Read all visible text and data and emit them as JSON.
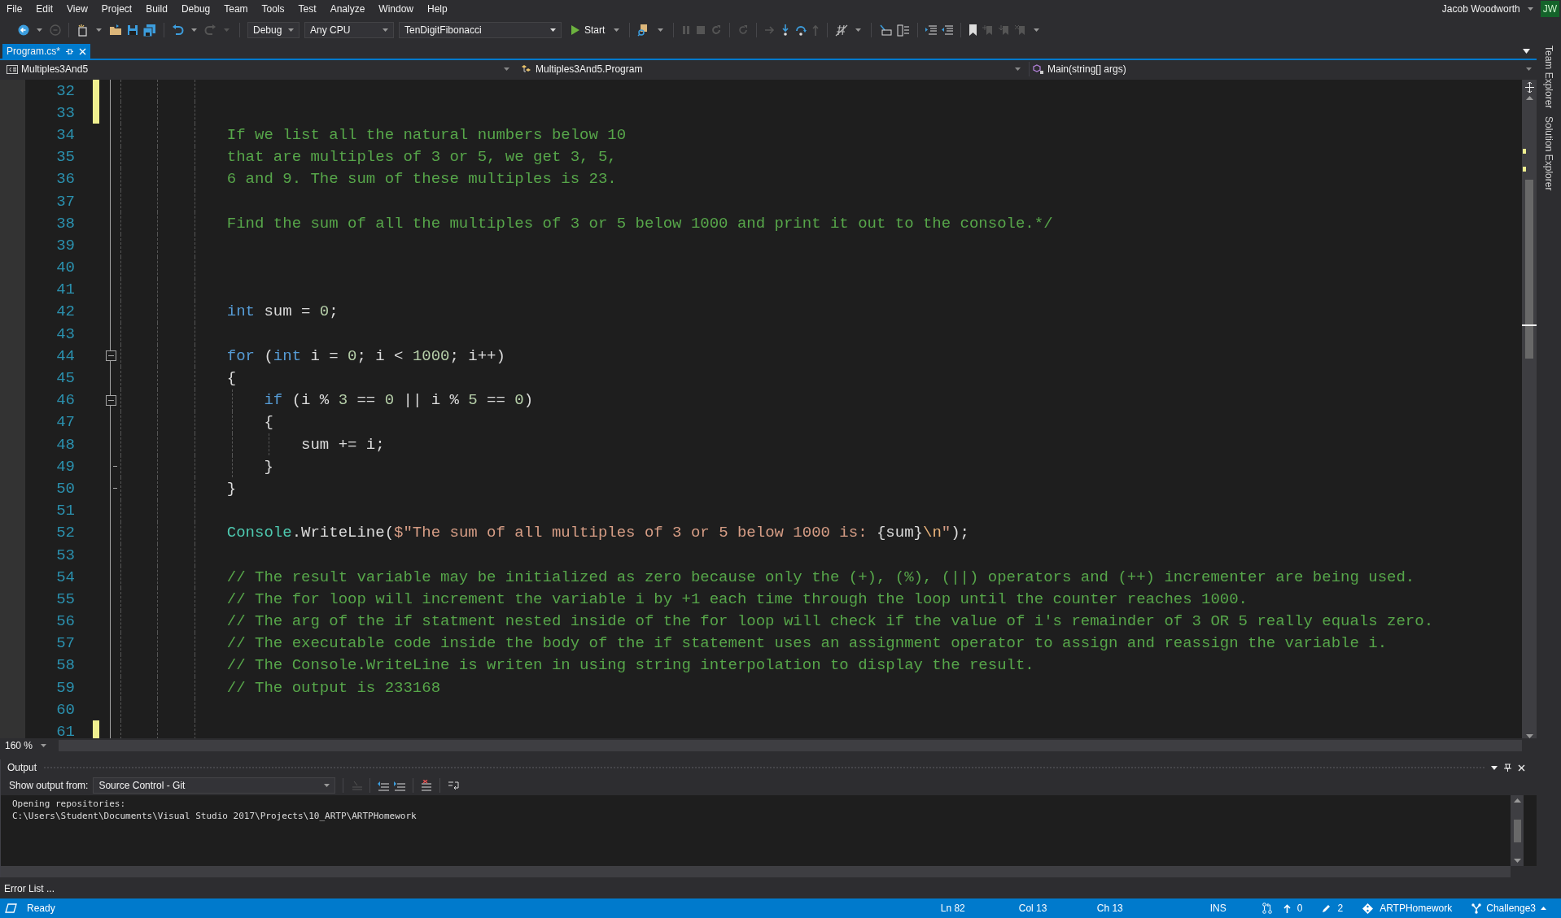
{
  "menu": [
    "File",
    "Edit",
    "View",
    "Project",
    "Build",
    "Debug",
    "Team",
    "Tools",
    "Test",
    "Analyze",
    "Window",
    "Help"
  ],
  "user": {
    "name": "Jacob Woodworth",
    "initials": "JW"
  },
  "toolbar": {
    "configuration": "Debug",
    "platform": "Any CPU",
    "startup_project": "TenDigitFibonacci",
    "start_label": "Start"
  },
  "tabs": [
    {
      "label": "Program.cs*",
      "selected": true
    }
  ],
  "navigation": {
    "project": "Multiples3And5",
    "type": "Multiples3And5.Program",
    "member": "Main(string[] args)"
  },
  "editor": {
    "zoom": "160 %",
    "lines": [
      {
        "n": "32",
        "changed": true
      },
      {
        "n": "33",
        "changed": true
      },
      {
        "n": "34",
        "changed": false,
        "tokens": [
          {
            "kind": "comment",
            "text": "If we list all the natural numbers below 10"
          }
        ]
      },
      {
        "n": "35",
        "changed": false,
        "tokens": [
          {
            "kind": "comment",
            "text": "that are multiples of 3 or 5, we get 3, 5,"
          }
        ]
      },
      {
        "n": "36",
        "changed": false,
        "tokens": [
          {
            "kind": "comment",
            "text": "6 and 9. The sum of these multiples is 23."
          }
        ]
      },
      {
        "n": "37",
        "changed": false
      },
      {
        "n": "38",
        "changed": false,
        "tokens": [
          {
            "kind": "comment",
            "text": "Find the sum of all the multiples of 3 or 5 below 1000 and print it out to the console.*/"
          }
        ]
      },
      {
        "n": "39",
        "changed": false
      },
      {
        "n": "40",
        "changed": false
      },
      {
        "n": "41",
        "changed": false
      },
      {
        "n": "42",
        "changed": false,
        "tokens": [
          {
            "kind": "keyword",
            "text": "int"
          },
          {
            "kind": "plain",
            "text": " sum = "
          },
          {
            "kind": "number",
            "text": "0"
          },
          {
            "kind": "plain",
            "text": ";"
          }
        ]
      },
      {
        "n": "43",
        "changed": false
      },
      {
        "n": "44",
        "changed": false,
        "expanded": true,
        "tokens": [
          {
            "kind": "keyword",
            "text": "for"
          },
          {
            "kind": "plain",
            "text": " ("
          },
          {
            "kind": "keyword",
            "text": "int"
          },
          {
            "kind": "plain",
            "text": " i = "
          },
          {
            "kind": "number",
            "text": "0"
          },
          {
            "kind": "plain",
            "text": "; i < "
          },
          {
            "kind": "number",
            "text": "1000"
          },
          {
            "kind": "plain",
            "text": "; i++)"
          }
        ]
      },
      {
        "n": "45",
        "changed": false,
        "tokens": [
          {
            "kind": "plain",
            "text": "{"
          }
        ]
      },
      {
        "n": "46",
        "changed": false,
        "expanded": true,
        "tokens": [
          {
            "kind": "keyword",
            "text": "    if"
          },
          {
            "kind": "plain",
            "text": " (i % "
          },
          {
            "kind": "number",
            "text": "3"
          },
          {
            "kind": "plain",
            "text": " == "
          },
          {
            "kind": "number",
            "text": "0"
          },
          {
            "kind": "plain",
            "text": " || i % "
          },
          {
            "kind": "number",
            "text": "5"
          },
          {
            "kind": "plain",
            "text": " == "
          },
          {
            "kind": "number",
            "text": "0"
          },
          {
            "kind": "plain",
            "text": ")"
          }
        ]
      },
      {
        "n": "47",
        "changed": false,
        "tokens": [
          {
            "kind": "plain",
            "text": "    {"
          }
        ]
      },
      {
        "n": "48",
        "changed": false,
        "tokens": [
          {
            "kind": "plain",
            "text": "        sum += i;"
          }
        ]
      },
      {
        "n": "49",
        "changed": false,
        "block_end": true,
        "tokens": [
          {
            "kind": "plain",
            "text": "    }"
          }
        ]
      },
      {
        "n": "50",
        "changed": false,
        "block_end": true,
        "tokens": [
          {
            "kind": "plain",
            "text": "}"
          }
        ]
      },
      {
        "n": "51",
        "changed": false
      },
      {
        "n": "52",
        "changed": false,
        "tokens": [
          {
            "kind": "type",
            "text": "Console"
          },
          {
            "kind": "plain",
            "text": ".WriteLine("
          },
          {
            "kind": "string",
            "text": "$\"The sum of all multiples of 3 or 5 below 1000 is: "
          },
          {
            "kind": "plain",
            "text": "{sum}"
          },
          {
            "kind": "escape",
            "text": "\\n"
          },
          {
            "kind": "string",
            "text": "\""
          },
          {
            "kind": "plain",
            "text": ");"
          }
        ]
      },
      {
        "n": "53",
        "changed": false
      },
      {
        "n": "54",
        "changed": false,
        "tokens": [
          {
            "kind": "comment",
            "text": "// The result variable may be initialized as zero because only the (+), (%), (||) operators and (++) incrementer are being used."
          }
        ]
      },
      {
        "n": "55",
        "changed": false,
        "tokens": [
          {
            "kind": "comment",
            "text": "// The for loop will increment the variable i by +1 each time through the loop until the counter reaches 1000."
          }
        ]
      },
      {
        "n": "56",
        "changed": false,
        "tokens": [
          {
            "kind": "comment",
            "text": "// The arg of the if statment nested inside of the for loop will check if the value of i's remainder of 3 OR 5 really equals zero."
          }
        ]
      },
      {
        "n": "57",
        "changed": false,
        "tokens": [
          {
            "kind": "comment",
            "text": "// The executable code inside the body of the if statement uses an assignment operator to assign and reassign the variable i."
          }
        ]
      },
      {
        "n": "58",
        "changed": false,
        "tokens": [
          {
            "kind": "comment",
            "text": "// The Console.WriteLine is writen in using string interpolation to display the result."
          }
        ]
      },
      {
        "n": "59",
        "changed": false,
        "tokens": [
          {
            "kind": "comment",
            "text": "// The output is 233168"
          }
        ]
      },
      {
        "n": "60",
        "changed": false
      },
      {
        "n": "61",
        "changed": true
      }
    ]
  },
  "side_tabs": [
    "Team Explorer",
    "Solution Explorer"
  ],
  "output": {
    "title": "Output",
    "source_label": "Show output from:",
    "source": "Source Control - Git",
    "lines": [
      "Opening repositories:",
      "C:\\Users\\Student\\Documents\\Visual Studio 2017\\Projects\\10_ARTP\\ARTPHomework"
    ]
  },
  "bottom_tabs": [
    "Error List ..."
  ],
  "status_bar": {
    "message": "Ready",
    "line": "Ln 82",
    "column": "Col 13",
    "char": "Ch 13",
    "mode": "INS",
    "incoming": "0",
    "pending_changes": "2",
    "repository": "ARTPHomework",
    "branch": "Challenge3"
  }
}
